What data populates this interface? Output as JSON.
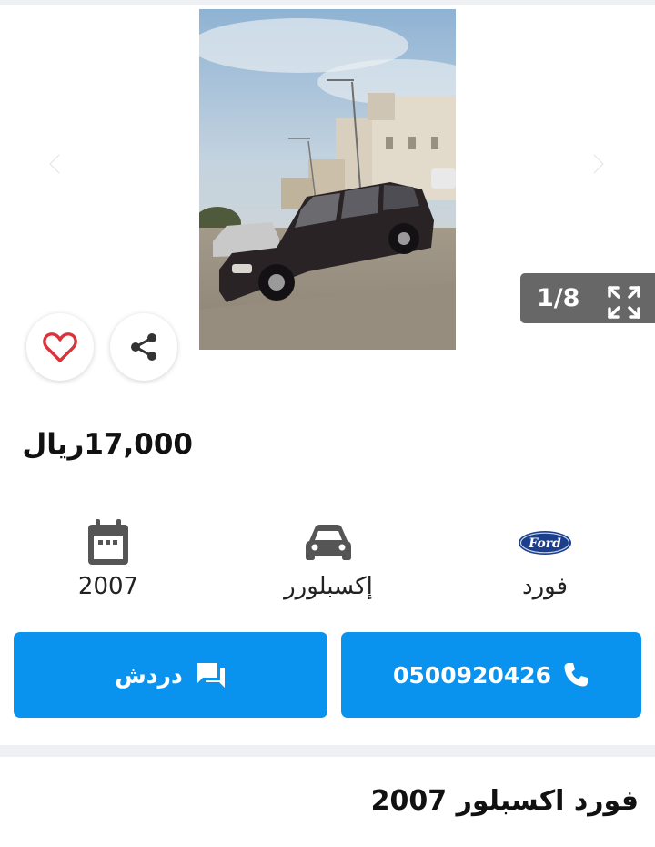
{
  "gallery": {
    "counter": "1/8"
  },
  "price": {
    "amount": "17,000",
    "currency": "ريال"
  },
  "specs": {
    "year": "2007",
    "model": "إكسبلورر",
    "brand": "فورد",
    "brand_logo_text": "Ford"
  },
  "actions": {
    "chat_label": "دردش",
    "phone": "0500920426"
  },
  "listing": {
    "title": "فورد اكسبلور 2007"
  },
  "colors": {
    "accent": "#0a93ee",
    "heart": "#d9343a",
    "counter_bg": "#676767"
  }
}
